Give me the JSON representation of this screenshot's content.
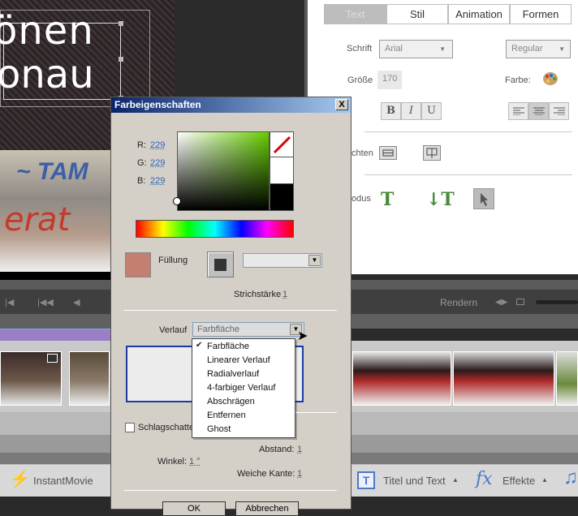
{
  "colors": {
    "fill_swatch": "#c47f70",
    "accent": "#0a246a"
  },
  "preview": {
    "line1": "önen",
    "line2": "onau"
  },
  "properties": {
    "tabs": [
      "Text",
      "Stil",
      "Animation",
      "Formen"
    ],
    "font_label": "Schrift",
    "font_value": "Arial",
    "style_value": "Regular",
    "size_label": "Größe",
    "size_value": "170",
    "color_label": "Farbe:",
    "bold": "B",
    "italic": "I",
    "underline": "U",
    "partial_label_1": "chten",
    "partial_label_2": "odus"
  },
  "timeline": {
    "render_label": "Rendern"
  },
  "bottom": {
    "instantmovie": "InstantMovie",
    "titles": "Titel und Text",
    "effects": "Effekte",
    "fx": "fx"
  },
  "dialog": {
    "title": "Farbeigenschaften",
    "close": "X",
    "r_label": "R:",
    "r_value": "229",
    "g_label": "G:",
    "g_value": "229",
    "b_label": "B:",
    "b_value": "229",
    "fill_label": "Füllung",
    "stroke_width_label": "Strichstärke",
    "stroke_width_value": "1",
    "gradient_label": "Verlauf",
    "gradient_value": "Farbfläche",
    "gradient_options": [
      "Farbfläche",
      "Linearer Verlauf",
      "Radialverlauf",
      "4-farbiger Verlauf",
      "Abschrägen",
      "Entfernen",
      "Ghost"
    ],
    "checked_option": "✔",
    "shadow_label": "Schlagschatten",
    "distance_label": "Abstand:",
    "distance_value": "1",
    "angle_label": "Winkel:",
    "angle_value": "1 °",
    "softness_label": "Weiche Kante:",
    "softness_value": "1",
    "ok": "OK",
    "cancel": "Abbrechen"
  }
}
